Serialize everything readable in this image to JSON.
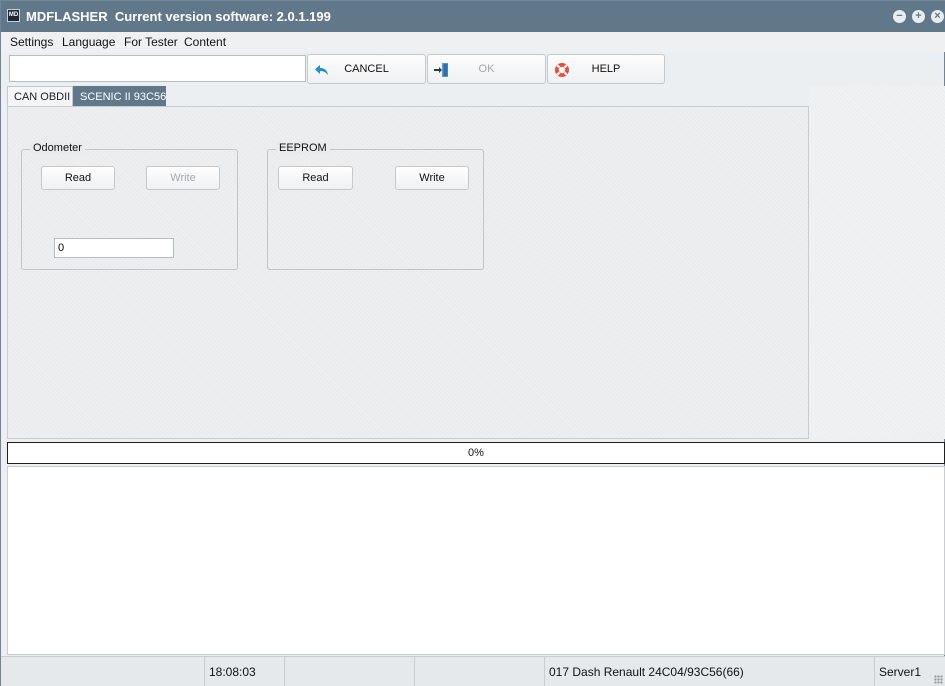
{
  "window": {
    "app_name": "MDFLASHER",
    "title": "Current version software: 2.0.1.199",
    "controls": [
      "minimize",
      "maximize",
      "close"
    ]
  },
  "menu": [
    "Settings",
    "Language",
    "For Tester",
    "Content"
  ],
  "toolbar": {
    "input_value": "",
    "cancel_label": "CANCEL",
    "ok_label": "OK",
    "help_label": "HELP"
  },
  "tabs": [
    {
      "label": "CAN OBDII",
      "active": false
    },
    {
      "label": "SCENIC II 93C56",
      "active": true
    }
  ],
  "odometer": {
    "title": "Odometer",
    "read_label": "Read",
    "write_label": "Write",
    "write_enabled": false,
    "value": "0"
  },
  "eeprom": {
    "title": "EEPROM",
    "read_label": "Read",
    "write_label": "Write"
  },
  "progress": {
    "percent": 0,
    "label": "0%"
  },
  "status": {
    "time": "18:08:03",
    "device": "017 Dash Renault  24C04/93C56(66)",
    "server": "Server1"
  },
  "colors": {
    "accent": "#61788b",
    "panel": "#e9ebed"
  },
  "icons": {
    "cancel": "back-arrow-icon",
    "ok": "exit-door-icon",
    "help": "lifebuoy-icon"
  }
}
